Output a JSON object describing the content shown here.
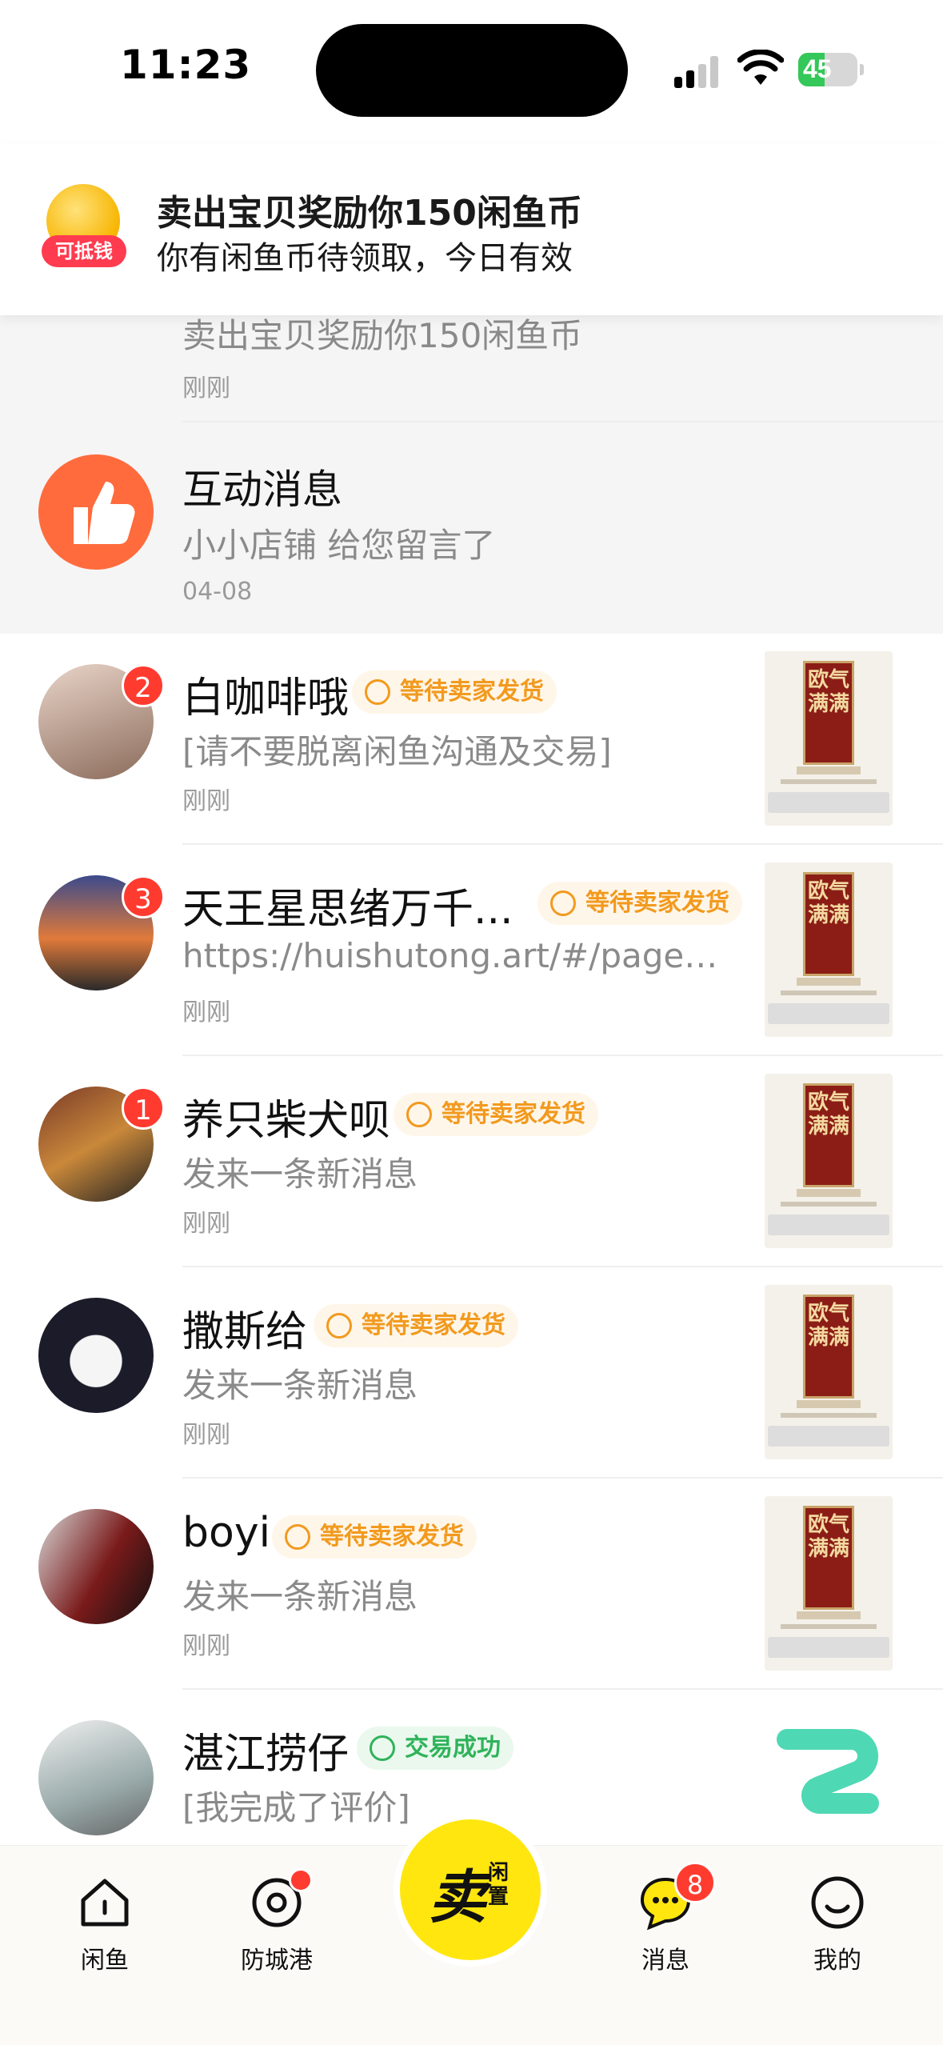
{
  "status_bar": {
    "time": "11:23",
    "battery": "45",
    "battery_level": 0.45
  },
  "banner": {
    "icon_label": "可抵钱",
    "title": "卖出宝贝奖励你150闲鱼币",
    "subtitle": "你有闲鱼币待领取，今日有效"
  },
  "system_rows": [
    {
      "title": "",
      "text": "卖出宝贝奖励你150闲鱼币",
      "time": "刚刚",
      "icon": "coin-icon",
      "color": "#f8c21b"
    },
    {
      "title": "互动消息",
      "text": "小小店铺 给您留言了",
      "time": "04-08",
      "icon": "thumbs-up-icon",
      "color": "#ff6b3d"
    }
  ],
  "chats": [
    {
      "name": "白咖啡哦",
      "badge": "2",
      "status": "等待卖家发货",
      "status_type": "wait",
      "message": "[请不要脱离闲鱼沟通及交易]",
      "time": "刚刚"
    },
    {
      "name": "天王星思绪万千...",
      "badge": "3",
      "status": "等待卖家发货",
      "status_type": "wait",
      "message": "https://huishutong.art/#/pages/...",
      "time": "刚刚"
    },
    {
      "name": "养只柴犬呗",
      "badge": "1",
      "status": "等待卖家发货",
      "status_type": "wait",
      "message": "发来一条新消息",
      "time": "刚刚"
    },
    {
      "name": "撒斯给",
      "badge": "",
      "status": "等待卖家发货",
      "status_type": "wait",
      "message": "发来一条新消息",
      "time": "刚刚"
    },
    {
      "name": "boyi",
      "badge": "",
      "status": "等待卖家发货",
      "status_type": "wait",
      "message": "发来一条新消息",
      "time": "刚刚"
    },
    {
      "name": "湛江捞仔",
      "badge": "",
      "status": "交易成功",
      "status_type": "done",
      "message": "[我完成了评价]",
      "time": ""
    }
  ],
  "thumb_text": "欧气满满",
  "tabbar": {
    "tabs": [
      {
        "label": "闲鱼",
        "icon": "home-icon"
      },
      {
        "label": "防城港",
        "icon": "location-icon"
      },
      {
        "label": "消息",
        "icon": "chat-icon",
        "badge": "8"
      },
      {
        "label": "我的",
        "icon": "profile-icon"
      }
    ],
    "sell": {
      "main": "卖",
      "side": "闲置"
    }
  }
}
